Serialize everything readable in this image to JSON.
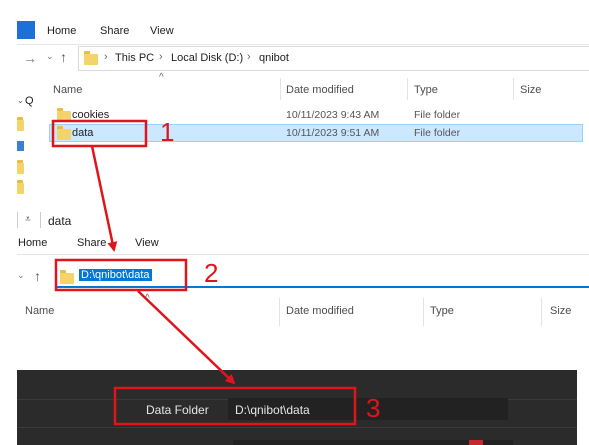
{
  "explorer1": {
    "ribbon_tabs": [
      "Home",
      "Share",
      "View"
    ],
    "breadcrumb": [
      "This PC",
      "Local Disk (D:)",
      "qnibot"
    ],
    "columns": [
      "Name",
      "Date modified",
      "Type",
      "Size"
    ],
    "rows": [
      {
        "name": "cookies",
        "date": "10/11/2023 9:43 AM",
        "type": "File folder"
      },
      {
        "name": "data",
        "date": "10/11/2023 9:51 AM",
        "type": "File folder"
      }
    ],
    "sidebar_fragments": [
      "Q"
    ]
  },
  "explorer2": {
    "title": "data",
    "ribbon_tabs": [
      "Home",
      "Share",
      "View"
    ],
    "address_value": "D:\\qnibot\\data",
    "columns": [
      "Name",
      "Date modified",
      "Type",
      "Size"
    ]
  },
  "app_panel": {
    "data_folder_label": "Data Folder",
    "data_folder_value": "D:\\qnibot\\data"
  },
  "annotations": {
    "step1": "1",
    "step2": "2",
    "step3": "3",
    "color": "#e0141b"
  },
  "colors": {
    "selection_bg": "#cce8ff",
    "selection_border": "#99d1ff",
    "address_highlight": "#0078d7",
    "panel_bg": "#2b2b2b",
    "field_bg": "#222222"
  }
}
